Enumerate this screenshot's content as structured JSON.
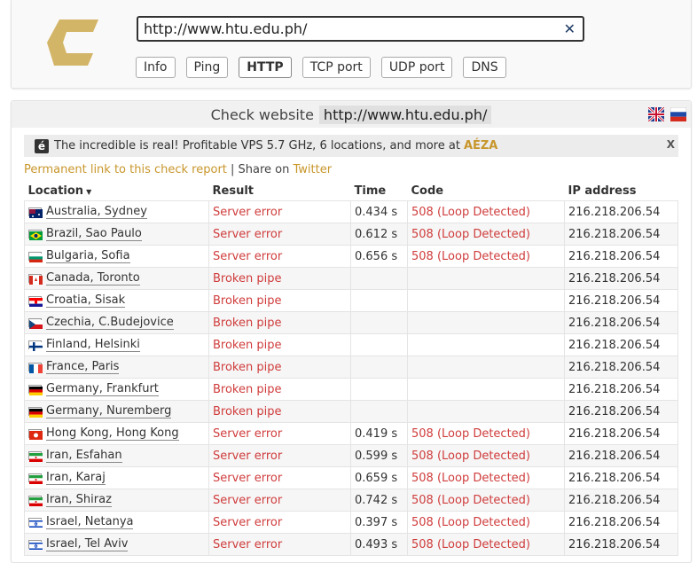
{
  "search": {
    "url": "http://www.htu.edu.ph/"
  },
  "tabs": [
    {
      "label": "Info"
    },
    {
      "label": "Ping"
    },
    {
      "label": "HTTP"
    },
    {
      "label": "TCP port"
    },
    {
      "label": "UDP port"
    },
    {
      "label": "DNS"
    }
  ],
  "check": {
    "title_prefix": "Check website",
    "url": "http://www.htu.edu.ph/"
  },
  "ad": {
    "badge": "é",
    "text": "The incredible is real! Profitable VPS 5.7 GHz, 6 locations, and more at",
    "brand": "AÉZA",
    "close": "X"
  },
  "links": {
    "permanent": "Permanent link to this check report",
    "sep": " | Share on ",
    "twitter": "Twitter"
  },
  "table": {
    "headers": [
      "Location",
      "Result",
      "Time",
      "Code",
      "IP address"
    ],
    "sort_arrow": "▼",
    "rows": [
      {
        "location": "Australia, Sydney",
        "result": "Server error",
        "time": "0.434 s",
        "code": "508 (Loop Detected)",
        "ip": "216.218.206.54",
        "flag": "au"
      },
      {
        "location": "Brazil, Sao Paulo",
        "result": "Server error",
        "time": "0.612 s",
        "code": "508 (Loop Detected)",
        "ip": "216.218.206.54",
        "flag": "br"
      },
      {
        "location": "Bulgaria, Sofia",
        "result": "Server error",
        "time": "0.656 s",
        "code": "508 (Loop Detected)",
        "ip": "216.218.206.54",
        "flag": "bg"
      },
      {
        "location": "Canada, Toronto",
        "result": "Broken pipe",
        "time": "",
        "code": "",
        "ip": "216.218.206.54",
        "flag": "ca"
      },
      {
        "location": "Croatia, Sisak",
        "result": "Broken pipe",
        "time": "",
        "code": "",
        "ip": "216.218.206.54",
        "flag": "hr"
      },
      {
        "location": "Czechia, C.Budejovice",
        "result": "Broken pipe",
        "time": "",
        "code": "",
        "ip": "216.218.206.54",
        "flag": "cz"
      },
      {
        "location": "Finland, Helsinki",
        "result": "Broken pipe",
        "time": "",
        "code": "",
        "ip": "216.218.206.54",
        "flag": "fi"
      },
      {
        "location": "France, Paris",
        "result": "Broken pipe",
        "time": "",
        "code": "",
        "ip": "216.218.206.54",
        "flag": "fr"
      },
      {
        "location": "Germany, Frankfurt",
        "result": "Broken pipe",
        "time": "",
        "code": "",
        "ip": "216.218.206.54",
        "flag": "de"
      },
      {
        "location": "Germany, Nuremberg",
        "result": "Broken pipe",
        "time": "",
        "code": "",
        "ip": "216.218.206.54",
        "flag": "de"
      },
      {
        "location": "Hong Kong, Hong Kong",
        "result": "Server error",
        "time": "0.419 s",
        "code": "508 (Loop Detected)",
        "ip": "216.218.206.54",
        "flag": "hk"
      },
      {
        "location": "Iran, Esfahan",
        "result": "Server error",
        "time": "0.599 s",
        "code": "508 (Loop Detected)",
        "ip": "216.218.206.54",
        "flag": "ir"
      },
      {
        "location": "Iran, Karaj",
        "result": "Server error",
        "time": "0.659 s",
        "code": "508 (Loop Detected)",
        "ip": "216.218.206.54",
        "flag": "ir"
      },
      {
        "location": "Iran, Shiraz",
        "result": "Server error",
        "time": "0.742 s",
        "code": "508 (Loop Detected)",
        "ip": "216.218.206.54",
        "flag": "ir"
      },
      {
        "location": "Israel, Netanya",
        "result": "Server error",
        "time": "0.397 s",
        "code": "508 (Loop Detected)",
        "ip": "216.218.206.54",
        "flag": "il"
      },
      {
        "location": "Israel, Tel Aviv",
        "result": "Server error",
        "time": "0.493 s",
        "code": "508 (Loop Detected)",
        "ip": "216.218.206.54",
        "flag": "il"
      }
    ]
  },
  "colors": {
    "accent": "#c8962b",
    "error": "#d03c3c",
    "logo": "#d3b567"
  }
}
